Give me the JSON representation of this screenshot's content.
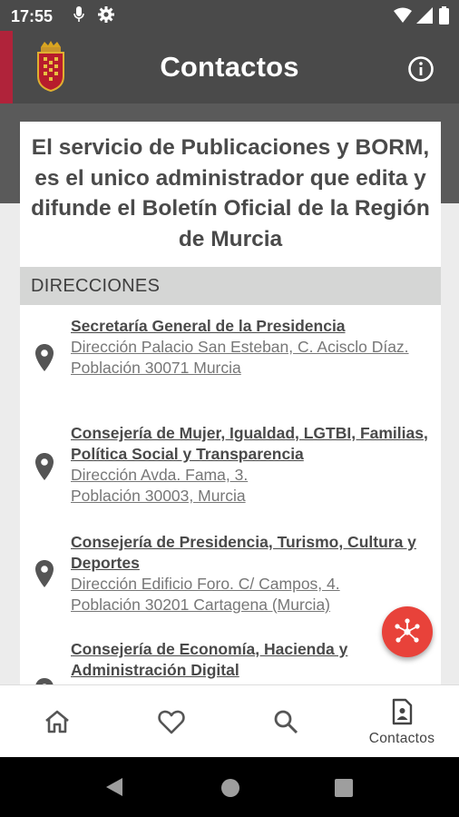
{
  "status_bar": {
    "time": "17:55",
    "icons": [
      "mic-icon",
      "gear-icon",
      "wifi-icon",
      "signal-icon",
      "battery-icon"
    ]
  },
  "app_bar": {
    "title": "Contactos",
    "logo": "murcia-crest",
    "action_icon": "info-icon",
    "background": "#4a4a4a",
    "accent": "#b0233a"
  },
  "intro_text": "El servicio de Publicaciones y BORM, es el unico administrador que edita y difunde el Boletín Oficial de la Región de Murcia",
  "section": {
    "title": "DIRECCIONES"
  },
  "addresses": [
    {
      "name": "Secretaría General de la Presidencia ",
      "direccion": "Dirección Palacio San Esteban, C. Acisclo Díaz. ",
      "poblacion": "Población 30071 Murcia "
    },
    {
      "name": "Consejería de Mujer, Igualdad, LGTBI, Familias, Política Social y Transparencia ",
      "direccion": "Dirección Avda. Fama, 3. ",
      "poblacion": "Población 30003, Murcia "
    },
    {
      "name": "Consejería de Presidencia, Turismo, Cultura y Deportes ",
      "direccion": "Dirección Edificio Foro. C/ Campos, 4. ",
      "poblacion": "Población 30201 Cartagena (Murcia) "
    },
    {
      "name": "Consejería de Economía, Hacienda y Administración Digital "
    }
  ],
  "fab": {
    "icon": "network-icon",
    "color": "#e8423a"
  },
  "bottom_nav": {
    "items": [
      {
        "icon": "home-icon",
        "label": ""
      },
      {
        "icon": "heart-icon",
        "label": ""
      },
      {
        "icon": "search-icon",
        "label": ""
      },
      {
        "icon": "contact-doc-icon",
        "label": "Contactos",
        "active": true
      }
    ]
  },
  "system_nav": [
    "back-icon",
    "home-circle-icon",
    "recents-icon"
  ]
}
